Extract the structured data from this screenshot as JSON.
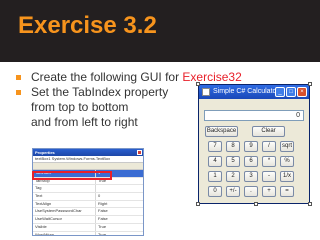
{
  "slide": {
    "title": "Exercise 3.2",
    "bullet1_text": "Create the following GUI for ",
    "bullet1_accent": "Exercise32",
    "bullet2_line1": "Set the TabIndex property",
    "bullet2_line2": "from top to bottom",
    "bullet2_line3": "and from left to right",
    "accent_color": "#f7941d",
    "highlight_color": "#e8202a"
  },
  "properties": {
    "title": "Properties",
    "object": "textBox1  System.Windows.Forms.TextBox",
    "rows": [
      {
        "k": "TabIndex",
        "v": "1"
      },
      {
        "k": "TabStop",
        "v": "True"
      },
      {
        "k": "Tag",
        "v": ""
      },
      {
        "k": "Text",
        "v": "0"
      },
      {
        "k": "TextAlign",
        "v": "Right"
      },
      {
        "k": "UseSystemPasswordChar",
        "v": "False"
      },
      {
        "k": "UseWaitCursor",
        "v": "False"
      },
      {
        "k": "Visible",
        "v": "True"
      },
      {
        "k": "WordWrap",
        "v": "True"
      }
    ]
  },
  "calculator": {
    "title": "Simple C# Calculator",
    "display_value": "0",
    "backspace": "Backspace",
    "clear": "Clear",
    "keys": [
      [
        "7",
        "8",
        "9",
        "/",
        "sqrt"
      ],
      [
        "4",
        "5",
        "6",
        "*",
        "%"
      ],
      [
        "1",
        "2",
        "3",
        "-",
        "1/x"
      ],
      [
        "0",
        "+/-",
        ".",
        "+",
        "="
      ]
    ]
  }
}
